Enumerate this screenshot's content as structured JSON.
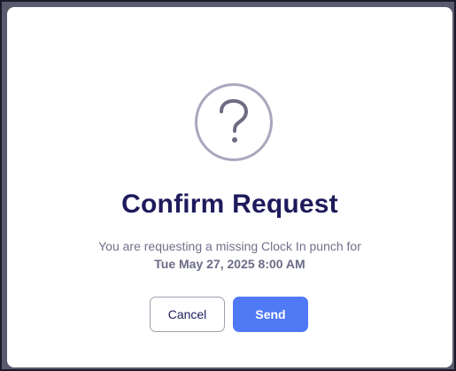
{
  "dialog": {
    "title": "Confirm Request",
    "message_line1": "You are requesting a missing Clock In punch for",
    "message_line2": "Tue May 27, 2025 8:00 AM",
    "icon": "question-mark-icon",
    "cancel_label": "Cancel",
    "send_label": "Send"
  },
  "colors": {
    "title": "#1e1b5c",
    "icon": "#a9a7bd",
    "primary_button": "#5079f6",
    "secondary_text": "#6f7189"
  }
}
